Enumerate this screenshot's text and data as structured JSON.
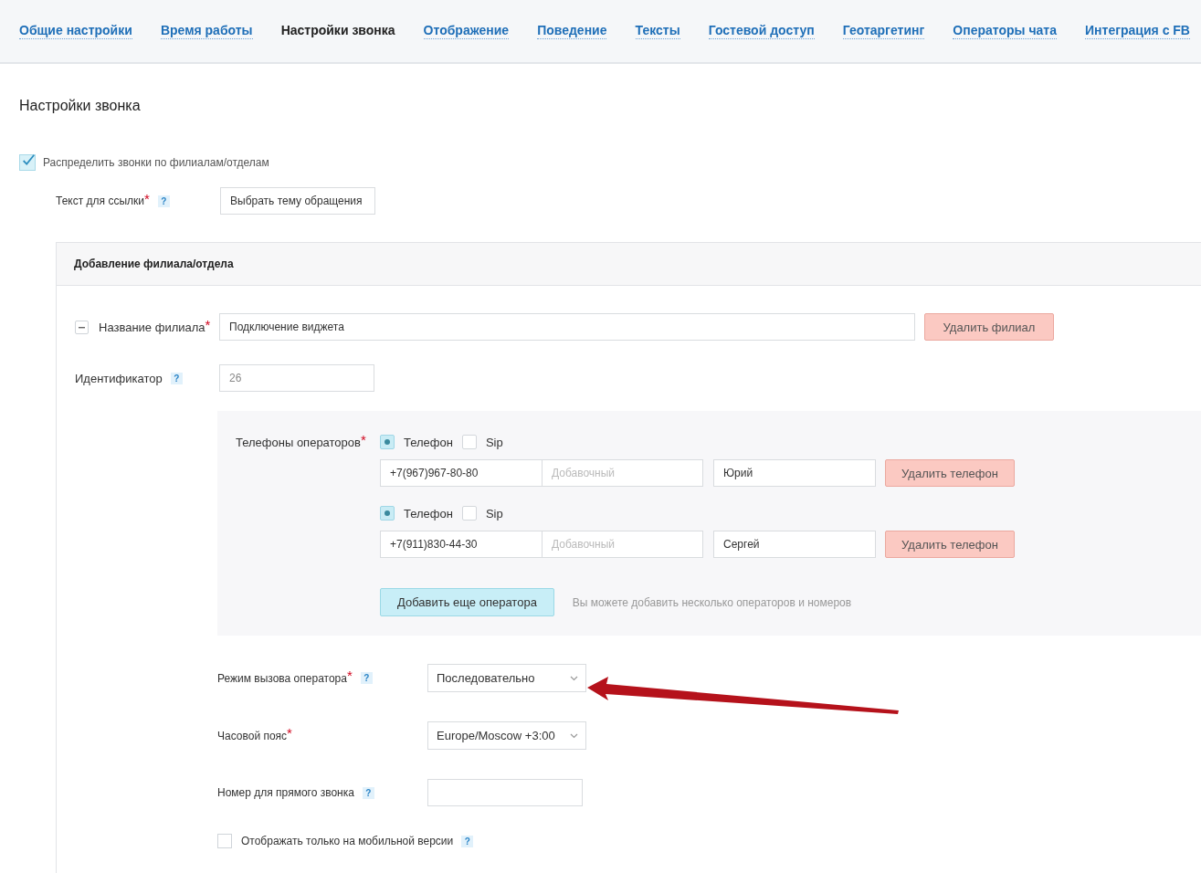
{
  "tabs": [
    {
      "label": "Общие настройки",
      "selected": false
    },
    {
      "label": "Время работы",
      "selected": false
    },
    {
      "label": "Настройки звонка",
      "selected": true
    },
    {
      "label": "Отображение",
      "selected": false
    },
    {
      "label": "Поведение",
      "selected": false
    },
    {
      "label": "Тексты",
      "selected": false
    },
    {
      "label": "Гостевой доступ",
      "selected": false
    },
    {
      "label": "Геотаргетинг",
      "selected": false
    },
    {
      "label": "Операторы чата",
      "selected": false
    },
    {
      "label": "Интеграция с FB",
      "selected": false
    }
  ],
  "title": "Настройки звонка",
  "distribute": {
    "label": "Распределить звонки по филиалам/отделам",
    "checked": true
  },
  "link_text": {
    "label": "Текст для ссылки",
    "required_mark": "*",
    "help": "?",
    "value": "Выбрать тему обращения"
  },
  "branch": {
    "header": "Добавление филиала/отдела",
    "name": {
      "label": "Название филиала",
      "required_mark": "*",
      "value": "Подключение виджета",
      "expanded": true
    },
    "delete_button": "Удалить филиал",
    "identifier": {
      "label": "Идентификатор",
      "help": "?",
      "value": "26",
      "disabled": true
    },
    "phones": {
      "label": "Телефоны операторов",
      "required_mark": "*",
      "entries": [
        {
          "types": [
            {
              "label": "Телефон",
              "selected": true
            },
            {
              "label": "Sip",
              "selected": false
            }
          ],
          "number": "+7(967)967-80-80",
          "extension_placeholder": "Добавочный",
          "operator": "Юрий",
          "delete_button": "Удалить телефон"
        },
        {
          "types": [
            {
              "label": "Телефон",
              "selected": true
            },
            {
              "label": "Sip",
              "selected": false
            }
          ],
          "number": "+7(911)830-44-30",
          "extension_placeholder": "Добавочный",
          "operator": "Сергей",
          "delete_button": "Удалить телефон"
        }
      ],
      "add_button": "Добавить еще оператора",
      "hint": "Вы можете добавить несколько операторов и номеров"
    },
    "call_mode": {
      "label": "Режим вызова оператора",
      "required_mark": "*",
      "help": "?",
      "value": "Последовательно"
    },
    "timezone": {
      "label": "Часовой пояс",
      "required_mark": "*",
      "value": "Europe/Moscow +3:00"
    },
    "direct_number": {
      "label": "Номер для прямого звонка",
      "help": "?"
    },
    "mobile_only": {
      "label": "Отображать только на мобильной версии",
      "help": "?",
      "checked": false
    }
  }
}
